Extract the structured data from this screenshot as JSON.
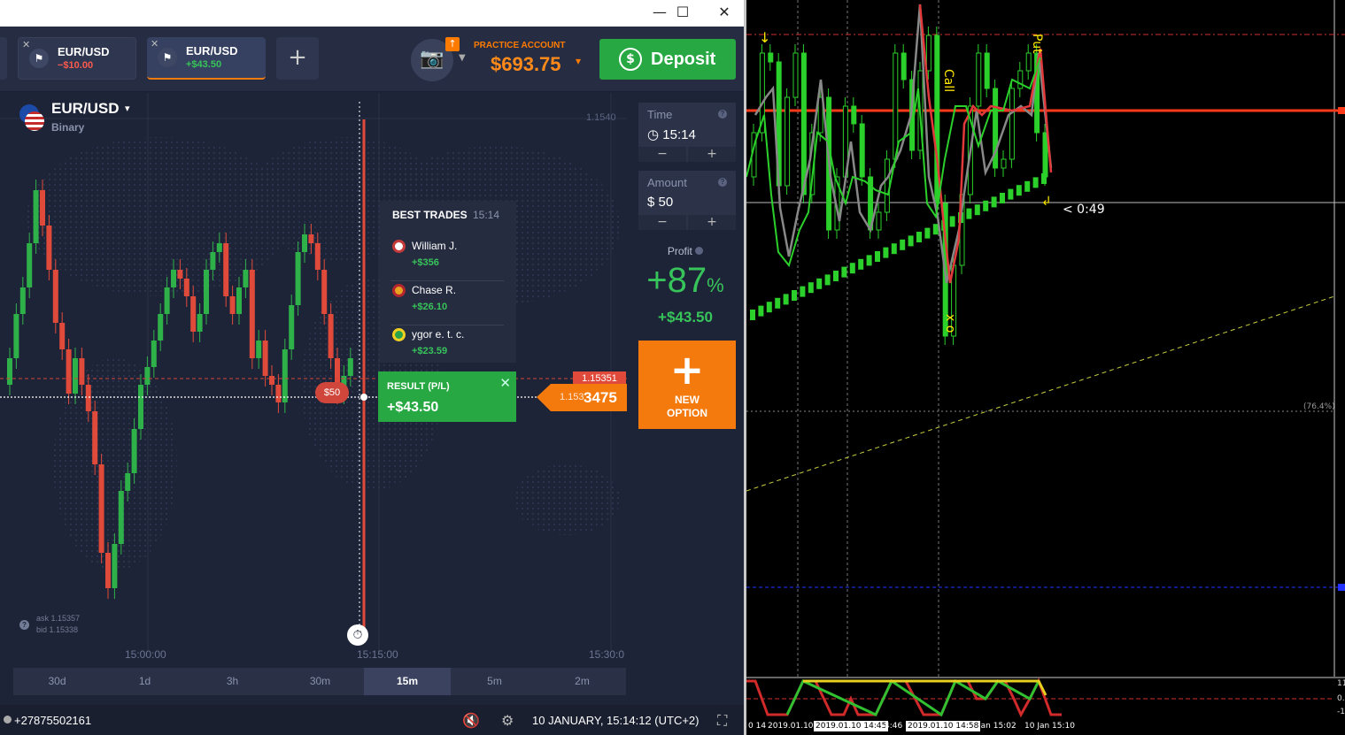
{
  "window": {
    "minimize_icon": "minimize-icon",
    "maximize_icon": "maximize-icon",
    "close_icon": "close-icon",
    "min_glyph": "—",
    "max_glyph": "☐",
    "close_glyph": "✕"
  },
  "tabs": [
    {
      "name": "EUR/USD",
      "pl": "−$10.00",
      "pl_color": "#ff5a4d",
      "close": "✕",
      "flag": "⚑"
    },
    {
      "name": "EUR/USD",
      "pl": "+$43.50",
      "pl_color": "#37c45a",
      "close": "✕",
      "flag": "⚑"
    }
  ],
  "add_tab": "+",
  "account": {
    "label": "PRACTICE ACCOUNT",
    "balance": "$693.75",
    "caret": "▾",
    "upgrade": "↑"
  },
  "camera_glyph": "📷",
  "deposit": {
    "label": "Deposit",
    "icon": "$"
  },
  "asset": {
    "name": "EUR/USD",
    "type": "Binary",
    "caret": "▾"
  },
  "chart_meta": {
    "price_tick": "1.1540",
    "ask": "ask 1.15357",
    "bid": "bid 1.15338",
    "xlabels": [
      "15:00:00",
      "15:15:00",
      "15:30:0"
    ],
    "sell_price": "1.15351",
    "current_price_a": "1.153",
    "current_price_b": "3475",
    "bet": "$50",
    "timer": "⏱"
  },
  "best_trades": {
    "title": "BEST TRADES",
    "time": "15:14",
    "rows": [
      {
        "name": "William J.",
        "amount": "+$356",
        "flag_color": "#ffffff"
      },
      {
        "name": "Chase R.",
        "amount": "+$26.10",
        "flag_color": "#e7a321"
      },
      {
        "name": "ygor e. t. c.",
        "amount": "+$23.59",
        "flag_color": "#2aa34a"
      }
    ]
  },
  "result": {
    "label": "RESULT (P/L)",
    "value": "+$43.50",
    "close": "✕"
  },
  "periods": [
    "30d",
    "1d",
    "3h",
    "30m",
    "15m",
    "5m",
    "2m"
  ],
  "active_period": "15m",
  "trade_box": {
    "time_label": "Time",
    "time_value": "15:14",
    "time_icon": "◷",
    "amount_label": "Amount",
    "amount_value": "$  50",
    "minus": "−",
    "plus": "+",
    "help": "?"
  },
  "profit": {
    "label": "Profit",
    "pct": "+87",
    "pct_sign": "%",
    "amount": "+$43.50"
  },
  "new_option": {
    "plus": "+",
    "label1": "NEW",
    "label2": "OPTION"
  },
  "footer": {
    "phone": "+27875502161",
    "datetime": "10 JANUARY, 15:14:12",
    "tz": "(UTC+2)",
    "mute": "🔇",
    "settings": "⚙",
    "fullscreen": "⛶"
  },
  "mt4": {
    "countdown": "< 0:49",
    "fib": "(76.4%)",
    "dates": [
      "0 14",
      "2019.01.10 1",
      "2019.01.10 14:45",
      "4:46",
      "2019.01.10 14:58",
      "Jan 15:02",
      "10 Jan 15:10"
    ],
    "axis_lower": [
      "11",
      "0.",
      "-1"
    ]
  }
}
